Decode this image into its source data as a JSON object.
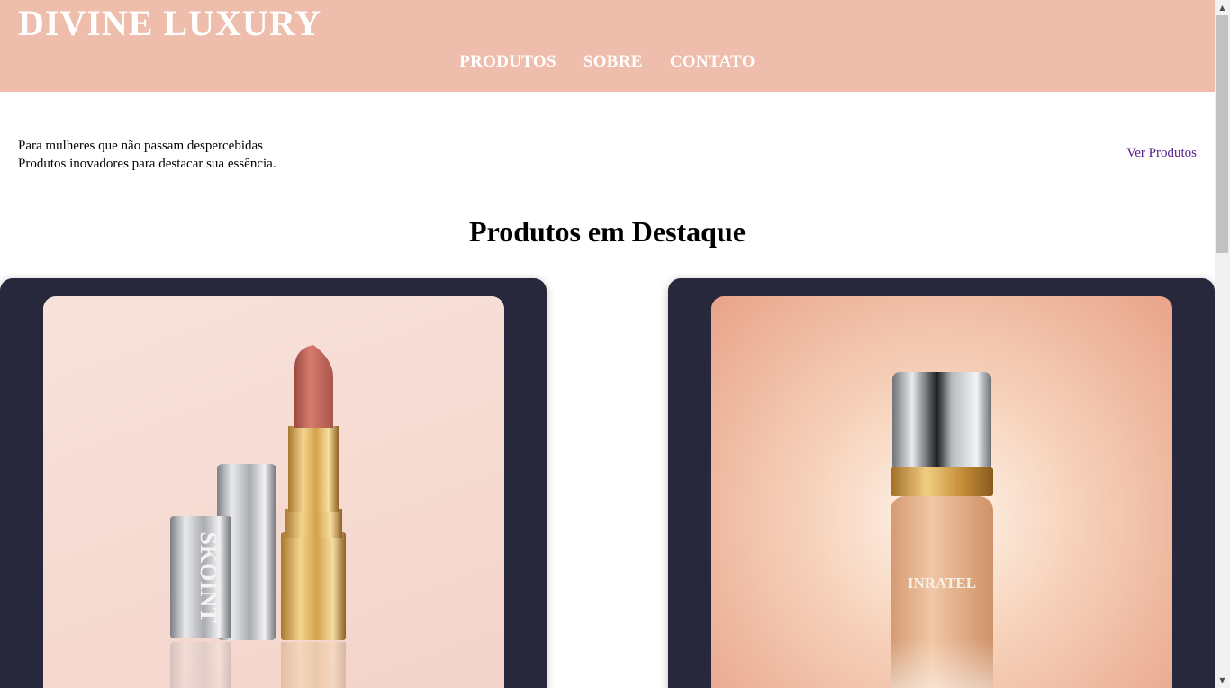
{
  "header": {
    "brand": "DIVINE LUXURY",
    "nav": [
      "PRODUTOS",
      "SOBRE",
      "CONTATO"
    ]
  },
  "hero": {
    "line1": "Para mulheres que não passam despercebidas",
    "line2": "Produtos inovadores para destacar sua essência.",
    "link": "Ver Produtos"
  },
  "featured": {
    "title": "Produtos em Destaque",
    "products": [
      {
        "image": "lipstick-image",
        "cap_text": "SKOINT"
      },
      {
        "image": "foundation-bottle-image",
        "label": "INRATEL"
      }
    ]
  },
  "colors": {
    "header_bg": "#eebdab",
    "card_bg": "#27283b",
    "link": "#551a8b"
  },
  "scrollbar": {
    "up_icon": "arrow-up-icon",
    "down_icon": "arrow-down-icon"
  }
}
